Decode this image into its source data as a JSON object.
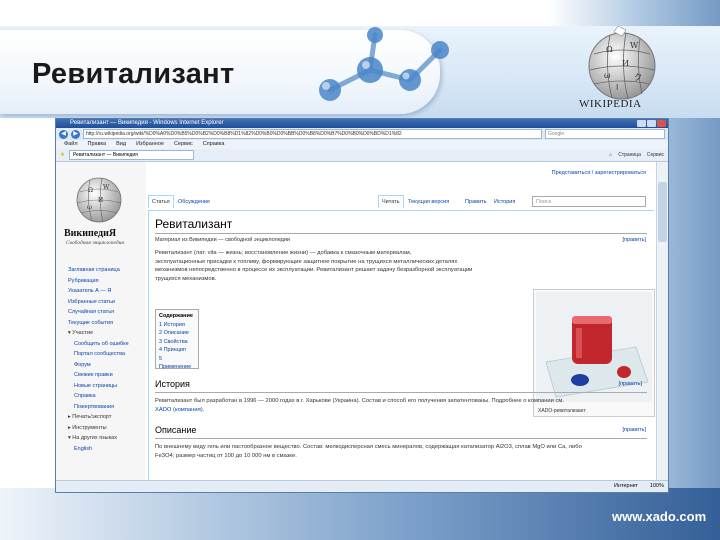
{
  "slide": {
    "title": "Ревитализант",
    "wikipedia_wordmark": "WIKIPEDIA",
    "footer_url": "www.xado.com"
  },
  "browser": {
    "window_title": "Ревитализант — Википедия - Windows Internet Explorer",
    "address": "http://ru.wikipedia.org/wiki/%D0%A0%D0%B5%D0%B2%D0%B8%D1%82%D0%B0%D0%BB%D0%B8%D0%B7%D0%B0%D0%BD%D1%82",
    "search_placeholder": "Google",
    "menu": [
      "Файл",
      "Правка",
      "Вид",
      "Избранное",
      "Сервис",
      "Справка"
    ],
    "favorites_tab": "Ревитализант — Википедия",
    "tools": [
      "Страница",
      "Сервис"
    ],
    "status_zone": "Интернет",
    "status_zoom": "100%"
  },
  "wiki": {
    "brand": "ВикипедиЯ",
    "slogan": "Свободная энциклопедия",
    "personal": "Представиться / зарегистрироваться",
    "nav": [
      {
        "label": "Заглавная страница",
        "type": "link"
      },
      {
        "label": "Рубрикация",
        "type": "link"
      },
      {
        "label": "Указатель А — Я",
        "type": "link"
      },
      {
        "label": "Избранные статьи",
        "type": "link"
      },
      {
        "label": "Случайная статья",
        "type": "link"
      },
      {
        "label": "Текущие события",
        "type": "link"
      },
      {
        "label": "▾ Участие",
        "type": "section"
      },
      {
        "label": "Сообщить об ошибке",
        "type": "indent"
      },
      {
        "label": "Портал сообщества",
        "type": "indent"
      },
      {
        "label": "Форум",
        "type": "indent"
      },
      {
        "label": "Свежие правки",
        "type": "indent"
      },
      {
        "label": "Новые страницы",
        "type": "indent"
      },
      {
        "label": "Справка",
        "type": "indent"
      },
      {
        "label": "Пожертвования",
        "type": "indent"
      },
      {
        "label": "▸ Печать/экспорт",
        "type": "section"
      },
      {
        "label": "▸ Инструменты",
        "type": "section"
      },
      {
        "label": "▾ На других языках",
        "type": "section"
      },
      {
        "label": "English",
        "type": "indent"
      }
    ],
    "tabs_left": [
      "Статья",
      "Обсуждение"
    ],
    "tabs_right": [
      "Читать",
      "Текущая версия",
      "Править",
      "История"
    ],
    "search_placeholder": "Поиск",
    "heading": "Ревитализант",
    "from": "Материал из Википедии — свободной энциклопедии",
    "edit_label": "[править]",
    "intro": [
      "Ревитализант (лат. vita — жизнь; восстановление жизни) — добавка к смазочным материалам,",
      "эксплуатационные присадки к топливу, формирующие защитное покрытие на трущихся металлических деталях",
      "механизмов непосредственно в процессе их эксплуатации. Ревитализант решает задачу безразборной эксплуатации",
      "трущихся механизмов."
    ],
    "toc_title": "Содержание",
    "toc": [
      "1 История",
      "2 Описание",
      "3 Свойства",
      "4 Принцип",
      "5 Применение"
    ],
    "image_caption": "XADO-ревитализант",
    "sections": [
      {
        "title": "История",
        "edit": "[править]",
        "text": [
          "Ревитализант был разработан в 1996 — 2000 годах в г. Харькове (Украина). Состав и способ его получения запатентованы. Подробнее о компании см.",
          "XADO (компания)."
        ]
      },
      {
        "title": "Описание",
        "edit": "[править]",
        "text": [
          "По внешнему виду гель или пастообразное вещество. Состав: мелкодисперсная смесь минералов, содержащая катализатор Al2O3, сплав MgO или Ca, либо",
          "Fe3O4; размер частиц от 100 до 10 000 нм в смазке."
        ]
      }
    ]
  }
}
